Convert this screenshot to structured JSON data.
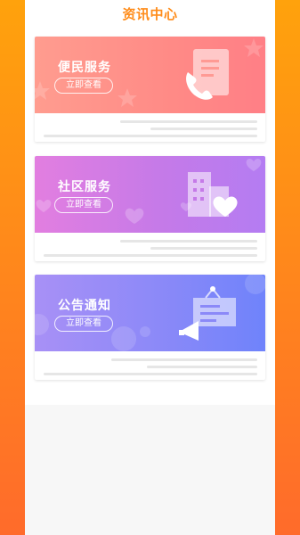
{
  "header": {
    "title": "资讯中心"
  },
  "cards": [
    {
      "label": "便民服务",
      "button": "立即查看",
      "icon": "phone-document-icon"
    },
    {
      "label": "社区服务",
      "button": "立即查看",
      "icon": "building-heart-icon"
    },
    {
      "label": "公告通知",
      "button": "立即查看",
      "icon": "megaphone-notice-icon"
    }
  ],
  "colors": {
    "header_title": "#ff8c1a",
    "card1": "#ff8a86",
    "card2": "#c57ae8",
    "card3": "#8b89f8"
  }
}
